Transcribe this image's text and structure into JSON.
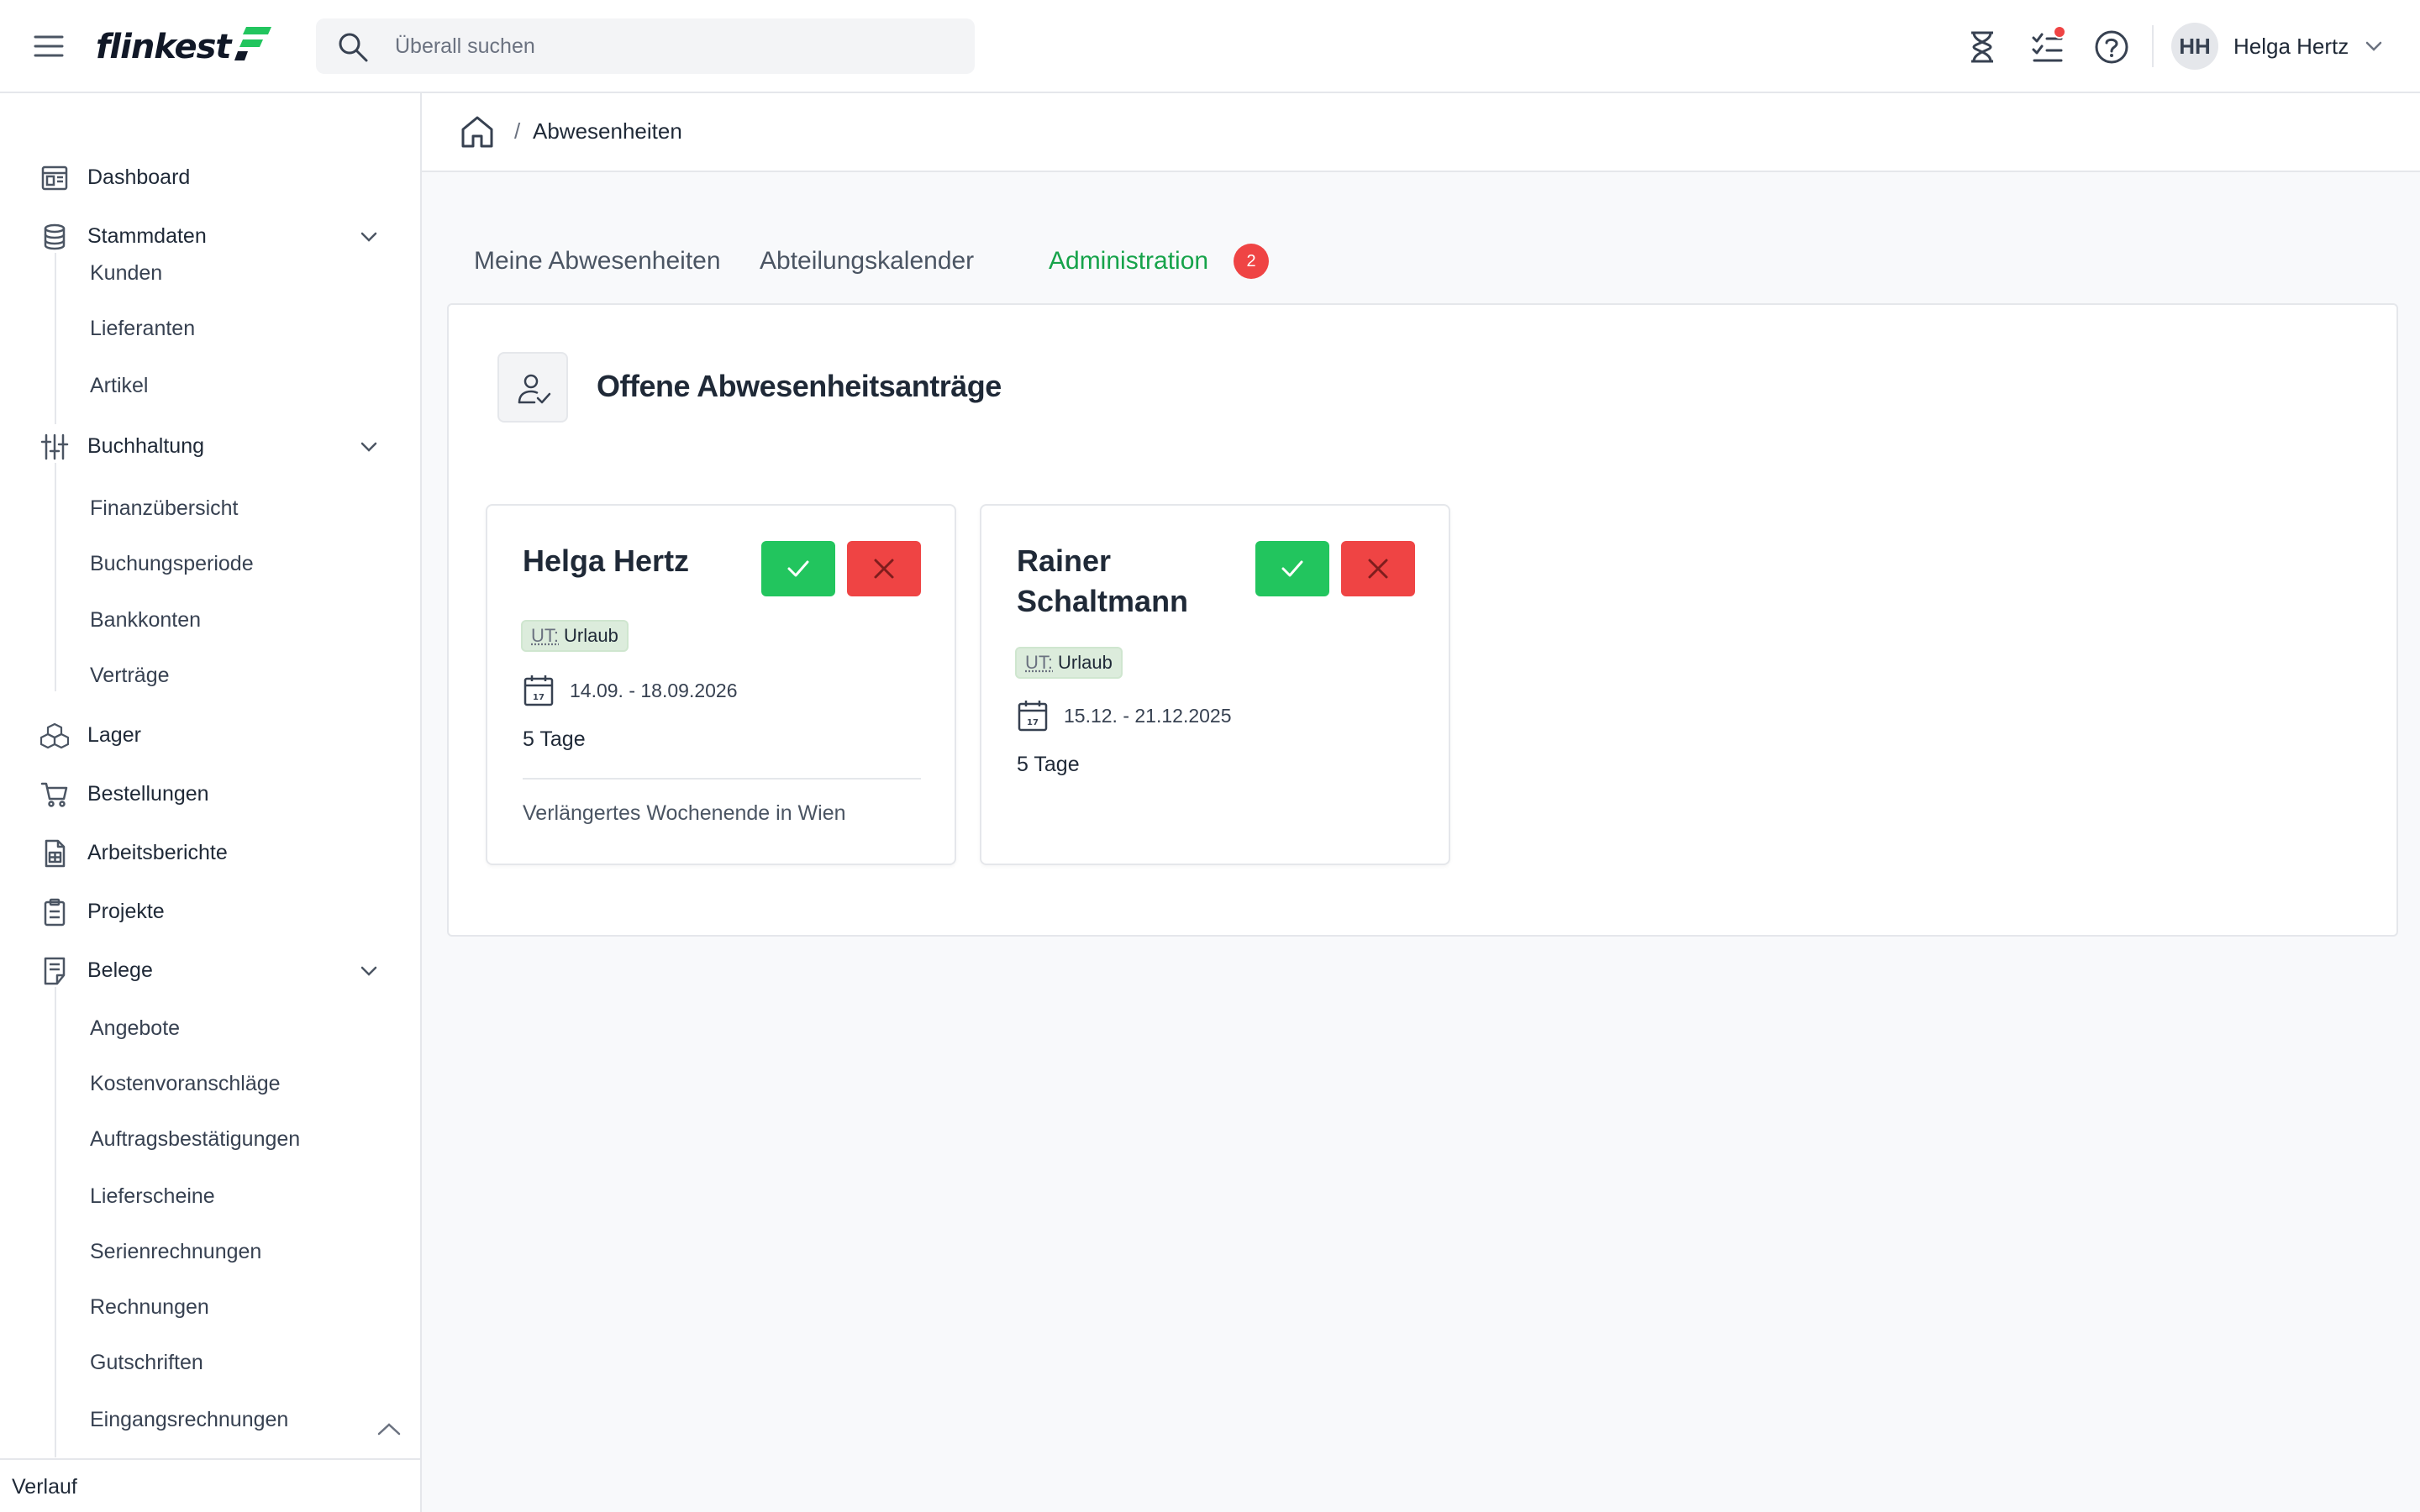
{
  "app": {
    "logo_text": "flinkest",
    "brand_color": "#22c55e",
    "search_placeholder": "Überall suchen"
  },
  "topbar": {
    "icons": [
      "menu-icon",
      "hourglass-icon",
      "tasks-icon",
      "help-icon",
      "chevron-down-icon"
    ],
    "tasks_has_notification": true,
    "user": {
      "initials": "HH",
      "name": "Helga Hertz"
    }
  },
  "sidebar": {
    "items": [
      {
        "label": "Dashboard",
        "icon": "dashboard-icon"
      },
      {
        "label": "Stammdaten",
        "icon": "database-icon",
        "expanded": true,
        "children": [
          "Kunden",
          "Lieferanten",
          "Artikel"
        ]
      },
      {
        "label": "Buchhaltung",
        "icon": "sliders-icon",
        "expanded": true,
        "children": [
          "Finanzübersicht",
          "Buchungsperiode",
          "Bankkonten",
          "Verträge"
        ]
      },
      {
        "label": "Lager",
        "icon": "boxes-icon"
      },
      {
        "label": "Bestellungen",
        "icon": "cart-icon"
      },
      {
        "label": "Arbeitsberichte",
        "icon": "report-icon"
      },
      {
        "label": "Projekte",
        "icon": "clipboard-icon"
      },
      {
        "label": "Belege",
        "icon": "receipt-icon",
        "expanded": true,
        "children": [
          "Angebote",
          "Kostenvoranschläge",
          "Auftragsbestätigungen",
          "Lieferscheine",
          "Serienrechnungen",
          "Rechnungen",
          "Gutschriften",
          "Eingangsrechnungen"
        ]
      }
    ],
    "footer_label": "Verlauf"
  },
  "breadcrumb": {
    "separator": "/",
    "current": "Abwesenheiten"
  },
  "tabs": [
    {
      "label": "Meine Abwesenheiten",
      "active": false
    },
    {
      "label": "Abteilungskalender",
      "active": false
    },
    {
      "label": "Administration",
      "active": true,
      "badge": "2"
    }
  ],
  "panel": {
    "title": "Offene Abwesenheitsanträge",
    "requests": [
      {
        "name": "Helga Hertz",
        "type_code": "UT:",
        "type_label": "Urlaub",
        "date_range": "14.09. - 18.09.2026",
        "days": "5 Tage",
        "reason": "Verlängertes Wochenende in Wien"
      },
      {
        "name": "Rainer Schaltmann",
        "type_code": "UT:",
        "type_label": "Urlaub",
        "date_range": "15.12. - 21.12.2025",
        "days": "5 Tage",
        "reason": ""
      }
    ]
  },
  "colors": {
    "approve": "#22c55e",
    "reject": "#ef4444",
    "active_tab": "#16a34a",
    "badge": "#ef4444"
  }
}
